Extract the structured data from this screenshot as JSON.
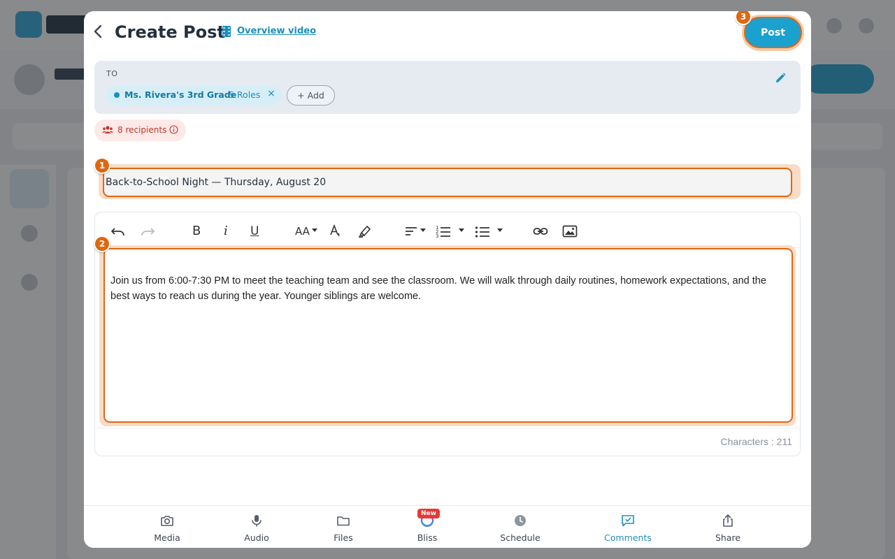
{
  "header": {
    "title": "Create Post",
    "overview_link": "Overview video",
    "post_label": "Post",
    "post_badge": "3"
  },
  "recipients_box": {
    "to_label": "TO",
    "chip_name": "Ms. Rivera's 3rd Grade",
    "chip_roles": "5 Roles",
    "chip_remove": "×",
    "add_label": "+ Add",
    "count_label": "8 recipients"
  },
  "title_field": {
    "badge": "1",
    "value": "Back-to-School Night — Thursday, August 20"
  },
  "editor": {
    "badge": "2",
    "aa_label": "AA",
    "bold_label": "B",
    "italic_label": "i",
    "underline_label": "U",
    "body": "Join us from 6:00-7:30 PM to meet the teaching team and see the classroom. We will walk through daily routines, homework expectations, and the best ways to reach us during the year. Younger siblings are welcome.",
    "char_count": "Characters : 211"
  },
  "footer": {
    "items": [
      {
        "label": "Media",
        "icon": "camera-icon"
      },
      {
        "label": "Audio",
        "icon": "microphone-icon"
      },
      {
        "label": "Files",
        "icon": "folder-icon"
      },
      {
        "label": "Bliss",
        "icon": "bliss-icon",
        "badge": "New"
      },
      {
        "label": "Schedule",
        "icon": "clock-icon"
      },
      {
        "label": "Comments",
        "icon": "comment-check-icon",
        "active": true
      },
      {
        "label": "Share",
        "icon": "share-icon"
      }
    ]
  },
  "colors": {
    "accent": "#1ba1cf",
    "highlight": "#e0670f",
    "recipients_text": "#c2362b",
    "new_badge": "#e53935"
  }
}
